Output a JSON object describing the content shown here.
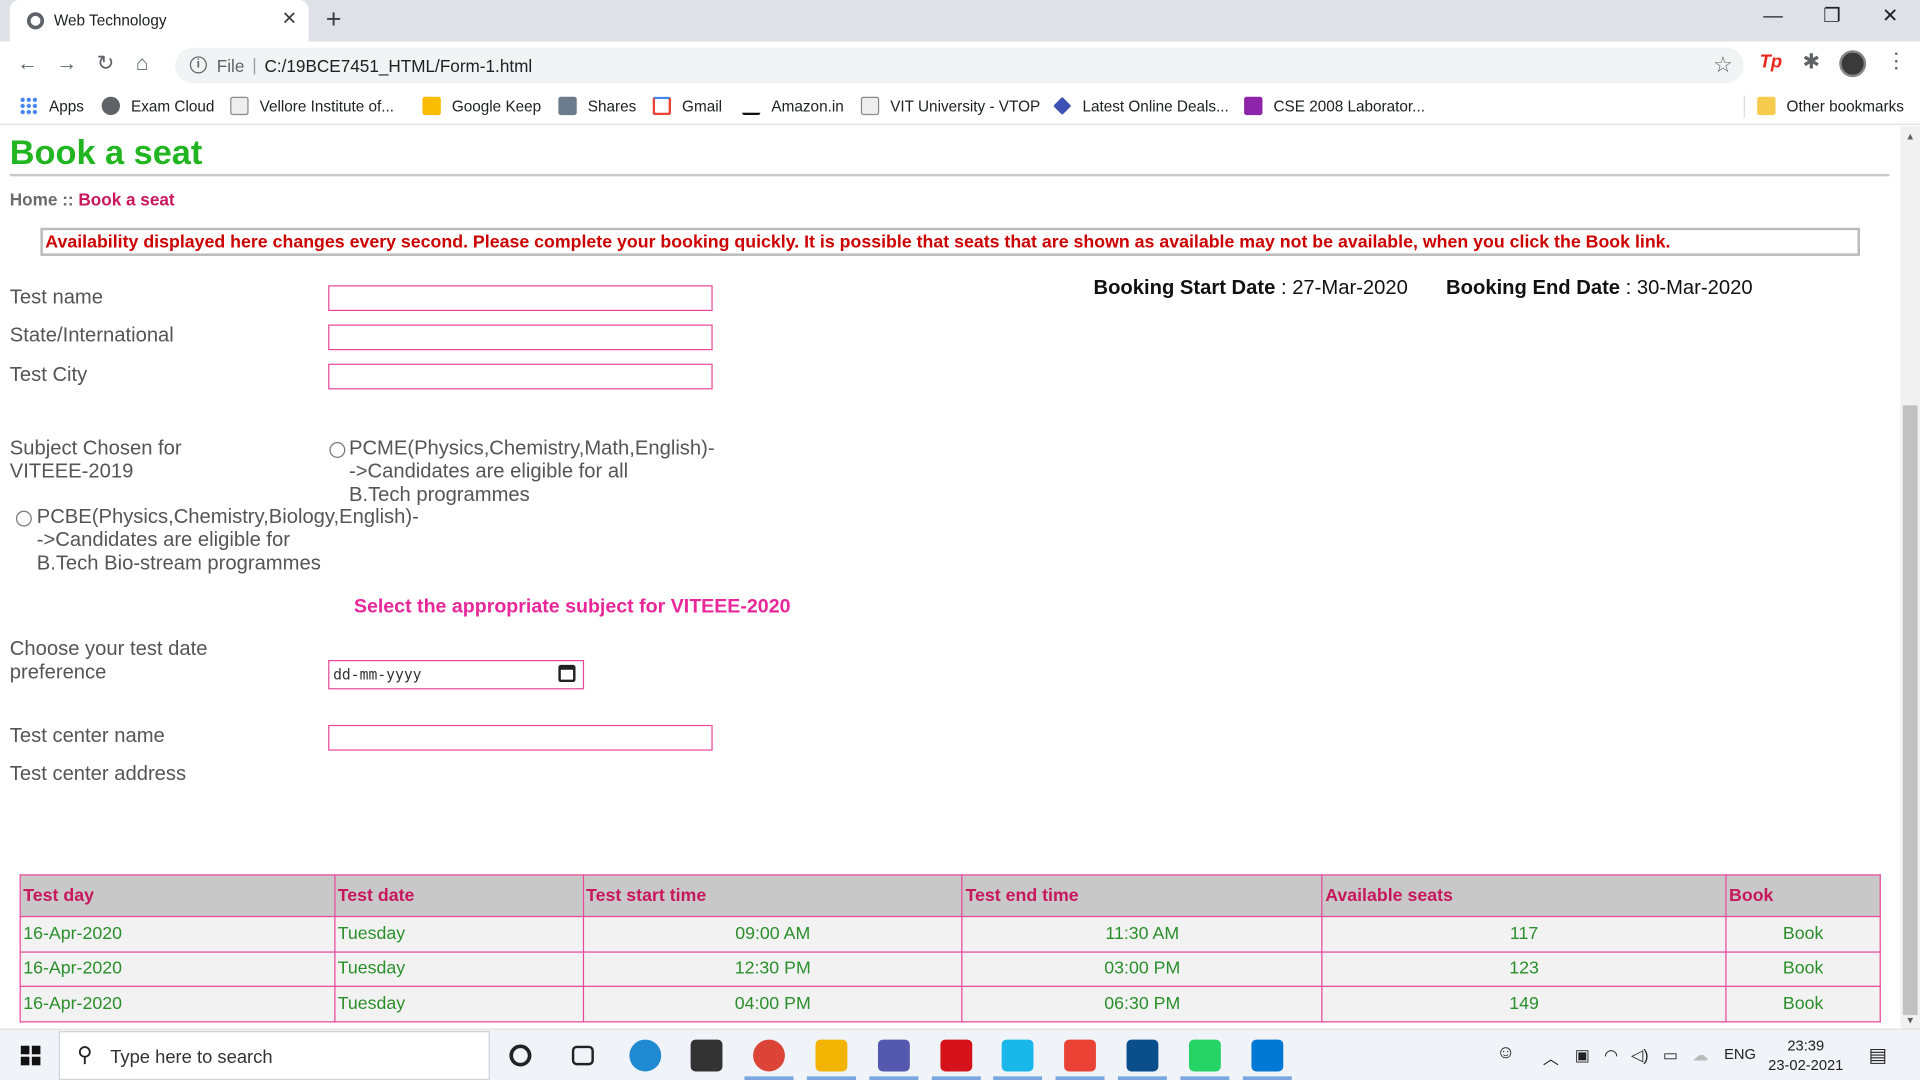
{
  "browser": {
    "tab_title": "Web Technology",
    "tab_close": "✕",
    "new_tab": "+",
    "window_controls": {
      "minimize": "—",
      "restore": "❐",
      "close": "✕"
    },
    "nav": {
      "back": "←",
      "forward": "→",
      "reload": "↻",
      "home": "⌂"
    },
    "omnibox": {
      "scheme_label": "File",
      "separator": "|",
      "url": "C:/19BCE7451_HTML/Form-1.html"
    },
    "star": "☆",
    "ext_tp": "Tp",
    "ext_puzzle": "✱",
    "menu": "⋮",
    "bookmarks": [
      {
        "label": "Apps",
        "icon": "apps-grid-icon",
        "color": "#4285f4"
      },
      {
        "label": "Exam Cloud",
        "icon": "globe-icon",
        "color": "#5f6368"
      },
      {
        "label": "Vellore Institute of...",
        "icon": "vit-logo-icon",
        "color": "#8a8a8a"
      },
      {
        "label": "Google Keep",
        "icon": "google-keep-icon",
        "color": "#fbbc04"
      },
      {
        "label": "Shares",
        "icon": "shares-icon",
        "color": "#6b7b8c"
      },
      {
        "label": "Gmail",
        "icon": "gmail-icon",
        "color": "#ea4335"
      },
      {
        "label": "Amazon.in",
        "icon": "amazon-icon",
        "color": "#111111"
      },
      {
        "label": "VIT University - VTOP",
        "icon": "vit-logo-icon",
        "color": "#8a8a8a"
      },
      {
        "label": "Latest Online Deals...",
        "icon": "deals-icon",
        "color": "#3f51b5"
      },
      {
        "label": "CSE 2008 Laborator...",
        "icon": "classroom-icon",
        "color": "#8e24aa"
      }
    ],
    "other_bookmarks": "Other bookmarks"
  },
  "page": {
    "title": "Book a seat",
    "breadcrumb": {
      "home": "Home",
      "sep": " :: ",
      "current": "Book a seat"
    },
    "notice": "Availability displayed here changes every second. Please complete your booking quickly. It is possible that seats that are shown as available may not be available, when you click the Book link.",
    "dates": {
      "start_label": "Booking Start Date",
      "start_value": " : 27-Mar-2020",
      "end_label": "Booking End Date",
      "end_value": " : 30-Mar-2020"
    },
    "form": {
      "test_name": "Test name",
      "state": "State/International",
      "city": "Test City",
      "subject_label_1": "Subject Chosen for",
      "subject_label_2": "VITEEE-2019",
      "option_pcme": [
        "PCME(Physics,Chemistry,Math,English)-",
        "->Candidates are eligible for all",
        "B.Tech programmes"
      ],
      "option_pcbe": [
        "PCBE(Physics,Chemistry,Biology,English)-",
        "->Candidates are eligible for",
        "B.Tech Bio-stream programmes"
      ],
      "select_msg": "Select the appropriate subject for VITEEE-2020",
      "date_label_1": "Choose your test date",
      "date_label_2": "preference",
      "date_placeholder": "dd-mm-yyyy",
      "center_name": "Test center name",
      "center_address": "Test center address"
    },
    "table": {
      "headers": [
        "Test day",
        "Test date",
        "Test start time",
        "Test end time",
        "Available seats",
        "Book"
      ],
      "rows": [
        [
          "16-Apr-2020",
          "Tuesday",
          "09:00 AM",
          "11:30 AM",
          "117",
          "Book"
        ],
        [
          "16-Apr-2020",
          "Tuesday",
          "12:30 PM",
          "03:00 PM",
          "123",
          "Book"
        ],
        [
          "16-Apr-2020",
          "Tuesday",
          "04:00 PM",
          "06:30 PM",
          "149",
          "Book"
        ]
      ]
    }
  },
  "taskbar": {
    "search_placeholder": "Type here to search",
    "lang": "ENG",
    "time": "23:39",
    "date": "23-02-2021",
    "apps": [
      {
        "name": "cortana-icon",
        "color": "#222222"
      },
      {
        "name": "task-view-icon",
        "color": "#222222"
      },
      {
        "name": "edge-icon",
        "color": "#1f8ad2"
      },
      {
        "name": "store-icon",
        "color": "#333333"
      },
      {
        "name": "chrome-icon",
        "color": "#db4437"
      },
      {
        "name": "file-explorer-icon",
        "color": "#f2b400"
      },
      {
        "name": "teams-icon",
        "color": "#5558af"
      },
      {
        "name": "acrobat-icon",
        "color": "#d6131b"
      },
      {
        "name": "prime-video-icon",
        "color": "#1ab7ea"
      },
      {
        "name": "gmail-icon",
        "color": "#ea4335"
      },
      {
        "name": "photos-icon",
        "color": "#0a4f8c"
      },
      {
        "name": "whatsapp-icon",
        "color": "#25d366"
      },
      {
        "name": "vscode-icon",
        "color": "#0078d4"
      }
    ]
  }
}
